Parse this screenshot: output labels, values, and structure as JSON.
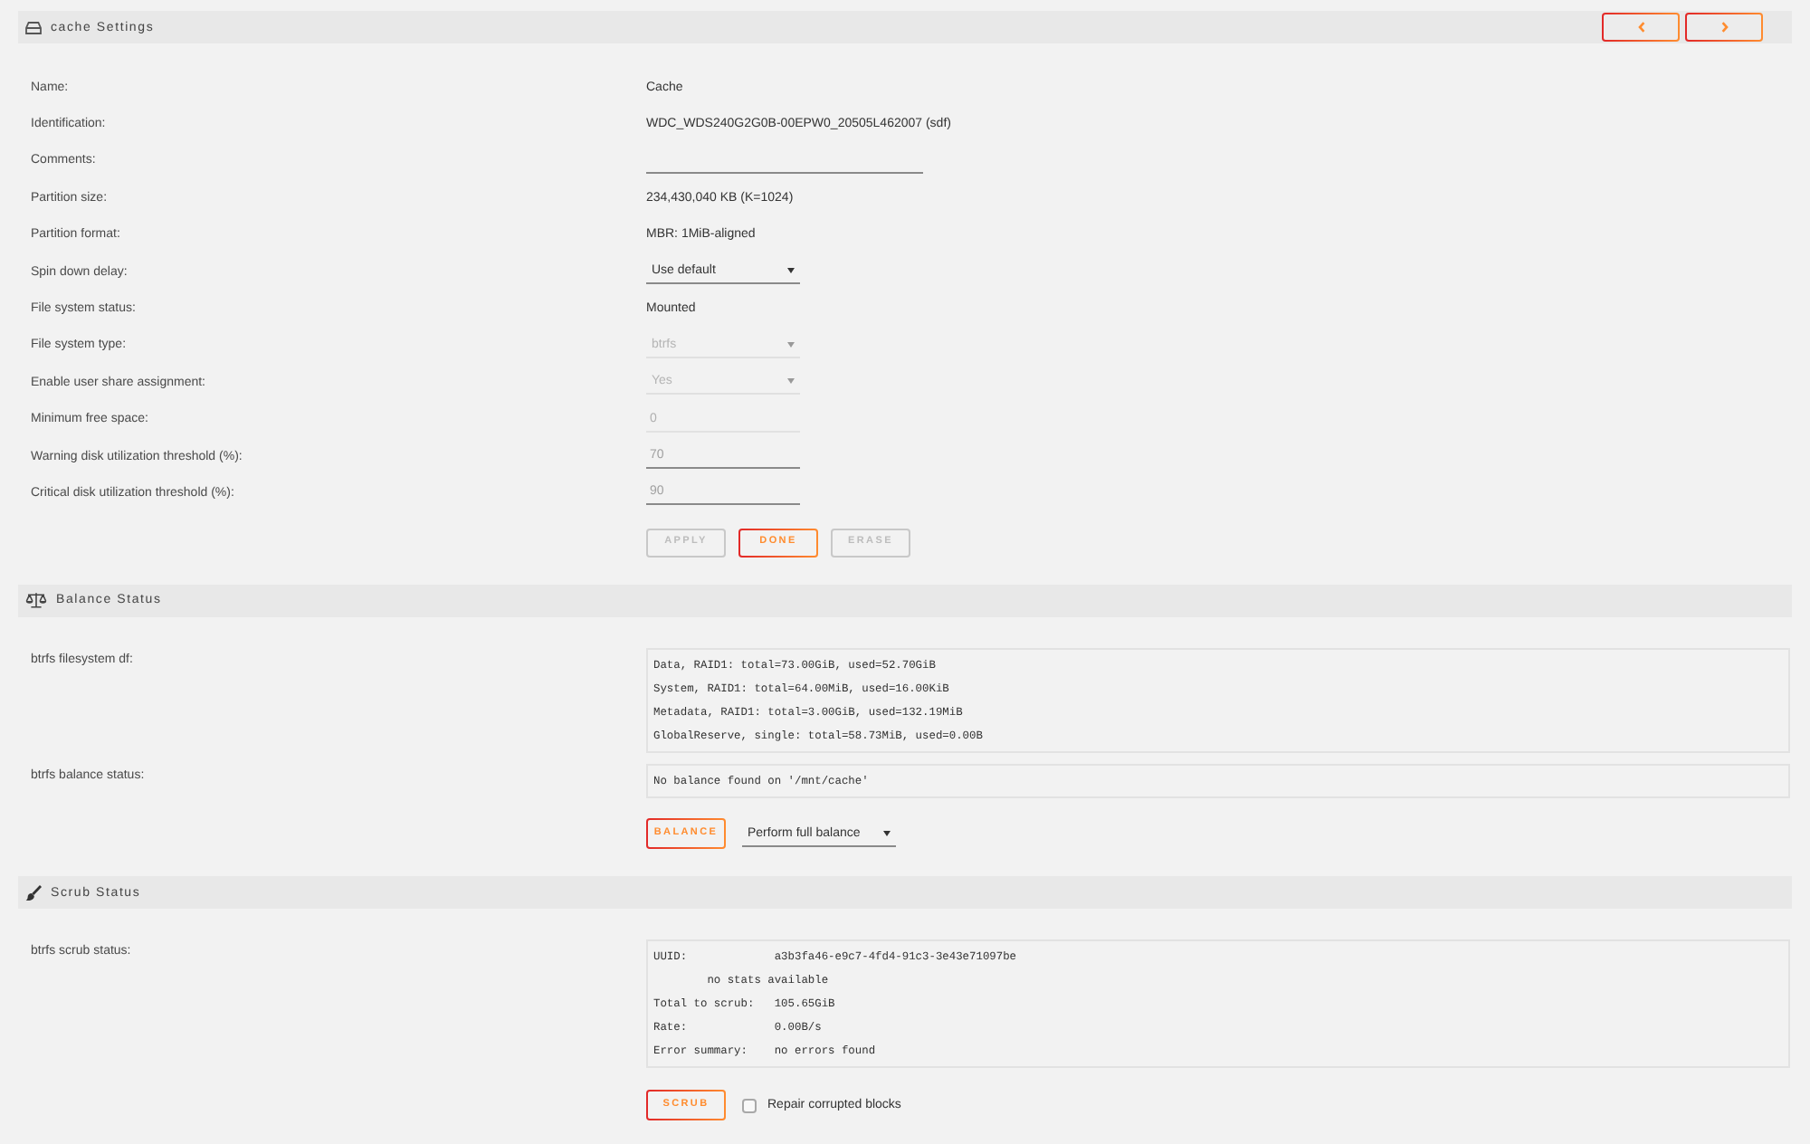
{
  "settings": {
    "title": "cache Settings",
    "rows": [
      {
        "label": "Name:",
        "kind": "text",
        "value": "Cache"
      },
      {
        "label": "Identification:",
        "kind": "text",
        "value": "WDC_WDS240G2G0B-00EPW0_20505L462007 (sdf)"
      },
      {
        "label": "Comments:",
        "kind": "textfield",
        "disabled": false
      },
      {
        "label": "Partition size:",
        "kind": "text",
        "value": "234,430,040 KB (K=1024)"
      },
      {
        "label": "Partition format:",
        "kind": "text",
        "value": "MBR: 1MiB-aligned"
      },
      {
        "label": "Spin down delay:",
        "kind": "select",
        "value": "Use default",
        "disabled": false
      },
      {
        "label": "File system status:",
        "kind": "text",
        "value": "Mounted"
      },
      {
        "label": "File system type:",
        "kind": "select",
        "value": "btrfs",
        "disabled": true
      },
      {
        "label": "Enable user share assignment:",
        "kind": "select",
        "value": "Yes",
        "disabled": true
      },
      {
        "label": "Minimum free space:",
        "kind": "numberfield",
        "value": "0",
        "disabled": true
      },
      {
        "label": "Warning disk utilization threshold (%):",
        "kind": "numberfield",
        "placeholder": "70",
        "disabled": false
      },
      {
        "label": "Critical disk utilization threshold (%):",
        "kind": "numberfield",
        "placeholder": "90",
        "disabled": false
      }
    ],
    "buttons": [
      {
        "label": "APPLY",
        "disabled": true
      },
      {
        "label": "DONE",
        "disabled": false
      },
      {
        "label": "ERASE",
        "disabled": true
      }
    ]
  },
  "balance": {
    "title": "Balance Status",
    "rows": [
      {
        "label": "btrfs filesystem df:",
        "lines": [
          "Data, RAID1: total=73.00GiB, used=52.70GiB",
          "System, RAID1: total=64.00MiB, used=16.00KiB",
          "Metadata, RAID1: total=3.00GiB, used=132.19MiB",
          "GlobalReserve, single: total=58.73MiB, used=0.00B"
        ]
      },
      {
        "label": "btrfs balance status:",
        "lines": [
          "No balance found on '/mnt/cache'"
        ]
      }
    ],
    "button": {
      "label": "BALANCE",
      "disabled": false
    },
    "select": {
      "value": "Perform full balance",
      "disabled": false
    }
  },
  "scrub": {
    "title": "Scrub Status",
    "rows": [
      {
        "label": "btrfs scrub status:",
        "lines": [
          "UUID:             a3b3fa46-e9c7-4fd4-91c3-3e43e71097be",
          "        no stats available",
          "Total to scrub:   105.65GiB",
          "Rate:             0.00B/s",
          "Error summary:    no errors found"
        ]
      }
    ],
    "button": {
      "label": "SCRUB",
      "disabled": false
    },
    "checkbox": {
      "label": "Repair corrupted blocks",
      "checked": false
    }
  }
}
